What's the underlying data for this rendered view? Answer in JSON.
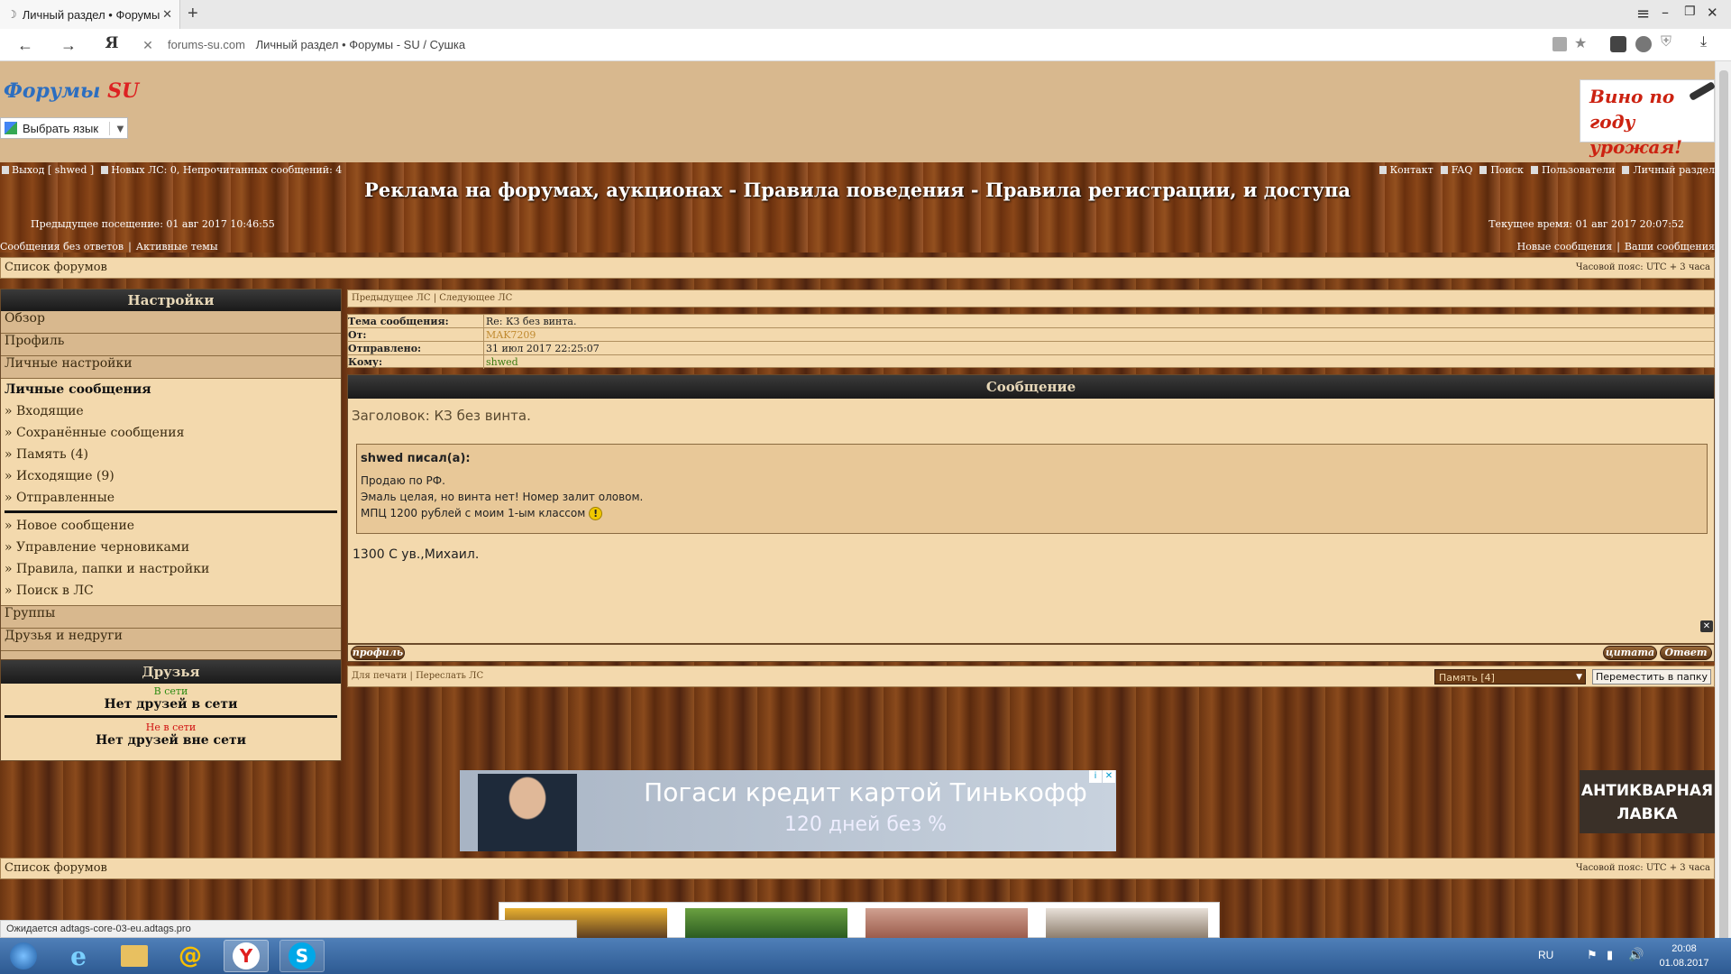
{
  "browser": {
    "tab_title": "Личный раздел • Форумы",
    "address_domain": "forums-su.com",
    "address_title": "Личный раздел • Форумы - SU / Сушка"
  },
  "header": {
    "logo_main": "Форумы",
    "logo_su": "SU",
    "lang_label": "Выбрать язык",
    "ad_wine_1": "Вино по",
    "ad_wine_2": "году урожая!"
  },
  "topbar": {
    "logout": "Выход [ shwed ]",
    "new_pm": "Новых ЛС: 0, Непрочитанных сообщений: 4",
    "contact": "Контакт",
    "faq": "FAQ",
    "search": "Поиск",
    "users": "Пользователи",
    "personal": "Личный раздел",
    "title": "Реклама на форумах, аукционах - Правила поведения - Правила регистрации, и доступа",
    "last_visit": "Предыдущее посещение: 01 авг 2017 10:46:55",
    "current_time": "Текущее время: 01 авг 2017 20:07:52",
    "no_replies": "Сообщения без ответов",
    "active": "Активные темы",
    "sep": "|",
    "new_posts": "Новые сообщения",
    "your_posts": "Ваши сообщения"
  },
  "breadcrumb": {
    "forums": "Список форумов",
    "tz": "Часовой пояс: UTC + 3 часа"
  },
  "sidebar": {
    "settings": "Настройки",
    "overview": "Обзор",
    "profile": "Профиль",
    "personal_settings": "Личные настройки",
    "pm": "Личные сообщения",
    "inbox": "» Входящие",
    "saved": "» Сохранённые сообщения",
    "memory": "» Память (4)",
    "outbox": "» Исходящие (9)",
    "sent": "» Отправленные",
    "new_msg": "» Новое сообщение",
    "drafts": "» Управление черновиками",
    "rules": "» Правила, папки и настройки",
    "pm_search": "» Поиск в ЛС",
    "groups": "Группы",
    "friends_foes": "Друзья и недруги",
    "friends": "Друзья",
    "online": "В сети",
    "no_online": "Нет друзей в сети",
    "offline": "Не в сети",
    "no_offline": "Нет друзей вне сети"
  },
  "message": {
    "prev": "Предыдущее ЛС",
    "next": "Следующее ЛС",
    "subject_label": "Тема сообщения:",
    "subject": "Re: КЗ без винта.",
    "from_label": "От:",
    "from": "MAK7209",
    "sent_label": "Отправлено:",
    "sent": "31 июл 2017 22:25:07",
    "to_label": "Кому:",
    "to": "shwed",
    "head": "Сообщение",
    "title_line": "Заголовок: КЗ без винта.",
    "quote_author": "shwed писал(а):",
    "quote_l1": "Продаю по РФ.",
    "quote_l2": "Эмаль целая, но винта нет! Номер залит оловом.",
    "quote_l3": "МПЦ 1200 рублей с моим 1-ым классом",
    "body": "1300 С ув.,Михаил.",
    "btn_profile": "профиль",
    "btn_quote": "цитата",
    "btn_reply": "Ответ",
    "print": "Для печати",
    "forward": "Переслать ЛС",
    "folder_select": "Память [4]",
    "move_btn": "Переместить в папку"
  },
  "ads": {
    "tinkoff_1": "Погаси кредит картой Тинькофф",
    "tinkoff_2": "120 дней без %",
    "antique_1": "АНТИКВАРНАЯ",
    "antique_2": "ЛАВКА"
  },
  "status": {
    "text": "Ожидается adtags-core-03-eu.adtags.pro"
  },
  "taskbar": {
    "lang": "RU",
    "time": "20:08",
    "date": "01.08.2017"
  }
}
